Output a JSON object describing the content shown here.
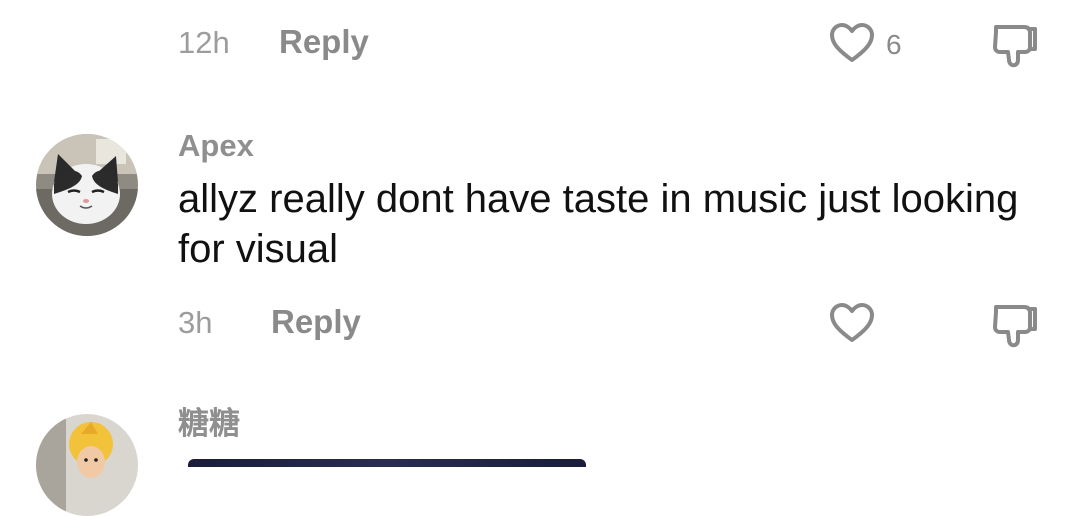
{
  "comments": [
    {
      "time": "12h",
      "reply_label": "Reply",
      "likes": "6"
    },
    {
      "username": "Apex",
      "text": "allyz really dont have taste in music just looking for visual",
      "time": "3h",
      "reply_label": "Reply",
      "likes": ""
    },
    {
      "username": "糖糖"
    }
  ],
  "colors": {
    "muted_text": "#8a8a8a",
    "body_text": "#111111",
    "icon_stroke": "#8a8a8a"
  },
  "icons": {
    "like": "heart-outline",
    "dislike": "thumbs-down-outline"
  }
}
